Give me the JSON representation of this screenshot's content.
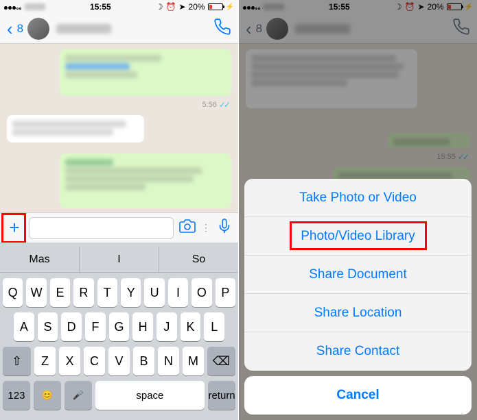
{
  "left": {
    "status": {
      "time": "15:55",
      "battery_pct": "20%",
      "battery_fill_pct": 20
    },
    "nav": {
      "back_count": "8"
    },
    "messages": {
      "time1": "5:56",
      "time2": ""
    },
    "keyboard": {
      "suggest1": "Mas",
      "suggest2": "I",
      "suggest3": "So",
      "row1": [
        "Q",
        "W",
        "E",
        "R",
        "T",
        "Y",
        "U",
        "I",
        "O",
        "P"
      ],
      "row2": [
        "A",
        "S",
        "D",
        "F",
        "G",
        "H",
        "J",
        "K",
        "L"
      ],
      "row3": [
        "Z",
        "X",
        "C",
        "V",
        "B",
        "N",
        "M"
      ],
      "numbers": "123",
      "space": "space",
      "return": "return"
    }
  },
  "right": {
    "status": {
      "time": "15:55",
      "battery_pct": "20%",
      "battery_fill_pct": 20
    },
    "nav": {
      "back_count": "8"
    },
    "messages": {
      "time1": "15:55",
      "time2": "15:55"
    },
    "sheet": {
      "item1": "Take Photo or Video",
      "item2": "Photo/Video Library",
      "item3": "Share Document",
      "item4": "Share Location",
      "item5": "Share Contact",
      "cancel": "Cancel"
    }
  }
}
